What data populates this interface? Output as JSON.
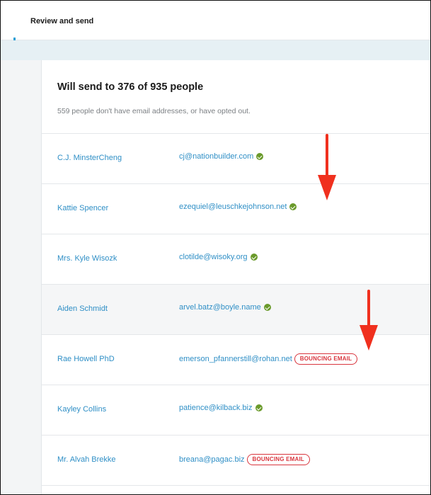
{
  "header": {
    "title": "Review and send"
  },
  "summary": {
    "title": "Will send to 376 of 935 people",
    "subtitle": "559 people don't have email addresses, or have opted out."
  },
  "recipients": [
    {
      "name": "C.J. MinsterCheng",
      "email": "cj@nationbuilder.com",
      "status": "verified",
      "badge": ""
    },
    {
      "name": "Kattie Spencer",
      "email": "ezequiel@leuschkejohnson.net",
      "status": "verified",
      "badge": ""
    },
    {
      "name": "Mrs. Kyle Wisozk",
      "email": "clotilde@wisoky.org",
      "status": "verified",
      "badge": ""
    },
    {
      "name": "Aiden Schmidt",
      "email": "arvel.batz@boyle.name",
      "status": "verified",
      "badge": ""
    },
    {
      "name": "Rae Howell PhD",
      "email": "emerson_pfannerstill@rohan.net",
      "status": "bouncing",
      "badge": "BOUNCING EMAIL"
    },
    {
      "name": "Kayley Collins",
      "email": "patience@kilback.biz",
      "status": "verified",
      "badge": ""
    },
    {
      "name": "Mr. Alvah Brekke",
      "email": "breana@pagac.biz",
      "status": "bouncing",
      "badge": "BOUNCING EMAIL"
    }
  ],
  "colors": {
    "link": "#2f8fc6",
    "verified": "#6a9a2b",
    "bouncing": "#d9363e",
    "annotation_arrow": "#f0301e"
  },
  "icons": {
    "verified": "check-circle-icon",
    "annotation": "red-arrow-icon"
  }
}
